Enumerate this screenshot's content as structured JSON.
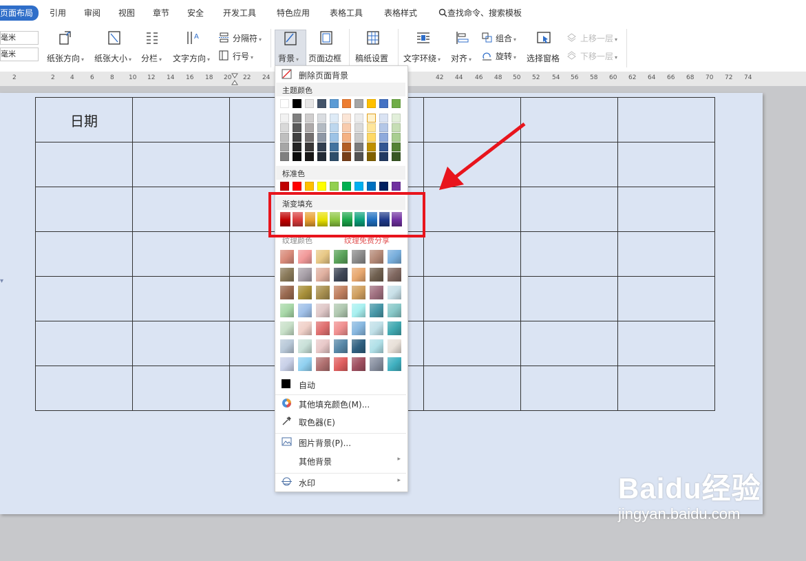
{
  "tabs": {
    "page_layout": "页面布局",
    "references": "引用",
    "review": "审阅",
    "view": "视图",
    "section": "章节",
    "security": "安全",
    "dev_tools": "开发工具",
    "features": "特色应用",
    "table_tools": "表格工具",
    "table_style": "表格样式",
    "search": "查找命令、搜索模板"
  },
  "ribbon": {
    "unit1": "毫米",
    "unit2": "毫米",
    "orientation": "纸张方向",
    "size": "纸张大小",
    "columns": "分栏",
    "text_direction": "文字方向",
    "breaks": "分隔符",
    "line_numbers": "行号",
    "background": "背景",
    "page_border": "页面边框",
    "manuscript": "稿纸设置",
    "text_wrap": "文字环绕",
    "align": "对齐",
    "group": "组合",
    "rotate": "旋转",
    "selection_pane": "选择窗格",
    "bring_forward": "上移一层",
    "send_backward": "下移一层"
  },
  "ruler": [
    "2",
    "2",
    "4",
    "6",
    "8",
    "10",
    "12",
    "14",
    "16",
    "18",
    "20",
    "22",
    "24",
    "42",
    "44",
    "46",
    "48",
    "50",
    "52",
    "54",
    "56",
    "58",
    "60",
    "62",
    "64",
    "66",
    "68",
    "70",
    "72",
    "74"
  ],
  "document": {
    "date_label": "日期"
  },
  "dropdown": {
    "remove_bg": "删除页面背景",
    "theme_colors": "主题颜色",
    "standard_colors": "标准色",
    "gradient_fill": "渐变填充",
    "texture_fill": "纹理颜色",
    "texture_more": "纹理免费分享",
    "auto": "自动",
    "more_fill": "其他填充颜色(M)...",
    "eyedropper": "取色器(E)",
    "picture_bg": "图片背景(P)...",
    "other_bg": "其他背景",
    "watermark": "水印"
  },
  "colors": {
    "theme_top": [
      "#ffffff",
      "#000000",
      "#e7e6e6",
      "#44546a",
      "#5b9bd5",
      "#ed7d31",
      "#a5a5a5",
      "#ffc000",
      "#4472c4",
      "#70ad47"
    ],
    "standard": [
      "#c00000",
      "#ff0000",
      "#ffc000",
      "#ffff00",
      "#92d050",
      "#00b050",
      "#00b0f0",
      "#0070c0",
      "#002060",
      "#7030a0"
    ],
    "gradient": [
      "#c00000",
      "#d93a3a",
      "#e8a030",
      "#e8e000",
      "#8cc63f",
      "#1aa64a",
      "#0aa07a",
      "#1f6fc0",
      "#1f3a8a",
      "#7030a0"
    ],
    "accent": "#2f6ec9",
    "highlight_box": "#e8141c"
  },
  "watermark_text": "Baidu经验",
  "watermark_url": "jingyan.baidu.com"
}
